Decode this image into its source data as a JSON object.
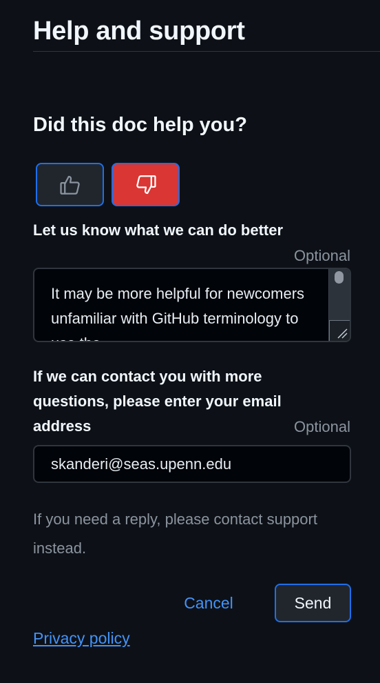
{
  "header": {
    "title": "Help and support"
  },
  "feedback": {
    "question": "Did this doc help you?",
    "thumbs_up_icon": "thumbs-up-icon",
    "thumbs_down_icon": "thumbs-down-icon",
    "selected": "thumbs-down"
  },
  "improve": {
    "label": "Let us know what we can do better",
    "optional": "Optional",
    "value": "It may be more helpful for newcomers unfamiliar with GitHub terminology to use the"
  },
  "contact": {
    "label": "If we can contact you with more questions, please enter your email address",
    "optional": "Optional",
    "value": "skanderi@seas.upenn.edu"
  },
  "note": "If you need a reply, please contact support instead.",
  "actions": {
    "cancel_label": "Cancel",
    "send_label": "Send"
  },
  "footer": {
    "privacy_label": "Privacy policy"
  },
  "colors": {
    "background": "#0d1117",
    "accent": "#4493f8",
    "border_focus": "#1f6feb",
    "danger": "#da3633",
    "muted": "#8b949e"
  }
}
